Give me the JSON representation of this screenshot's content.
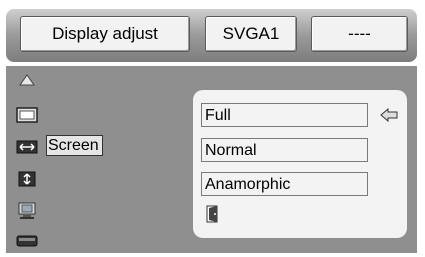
{
  "topbar": {
    "title": "Display adjust",
    "mode": "SVGA1",
    "value": "----"
  },
  "sidebar": {
    "active_label": "Screen",
    "icons": [
      "up-arrow-icon",
      "screen-icon",
      "horizontal-resize-icon",
      "vertical-resize-icon",
      "monitor-icon",
      "bottom-bar-icon"
    ]
  },
  "panel": {
    "options": [
      "Full",
      "Normal",
      "Anamorphic"
    ],
    "selected": "Full"
  }
}
